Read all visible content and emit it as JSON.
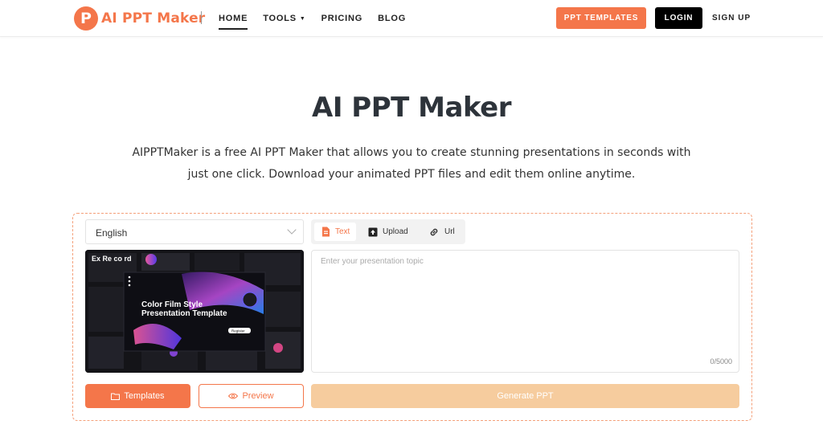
{
  "nav": {
    "logo_letter": "P",
    "logo_text": "AI PPT Maker",
    "links": [
      {
        "label": "HOME",
        "active": true
      },
      {
        "label": "TOOLS",
        "has_caret": true
      },
      {
        "label": "PRICING"
      },
      {
        "label": "BLOG"
      }
    ],
    "ppt_templates": "PPT TEMPLATES",
    "login": "LOGIN",
    "signup": "SIGN UP"
  },
  "hero": {
    "title": "AI PPT Maker",
    "description": "AIPPTMaker is a free AI PPT Maker that allows you to create stunning presentations in seconds with just one click. Download your animated PPT files and edit them online anytime."
  },
  "generator": {
    "language": "English",
    "preview_image": {
      "slide_title_line1": "Color Film Style",
      "slide_title_line2": "Presentation Template",
      "slide_button": "Register",
      "side_text": "Ex Re co rd"
    },
    "tabs": [
      {
        "label": "Text",
        "icon": "document-icon",
        "active": true
      },
      {
        "label": "Upload",
        "icon": "upload-icon"
      },
      {
        "label": "Url",
        "icon": "link-icon"
      }
    ],
    "topic_placeholder": "Enter your presentation topic",
    "counter": "0/5000",
    "templates_button": "Templates",
    "preview_button": "Preview",
    "generate_button": "Generate PPT"
  },
  "colors": {
    "accent": "#f4764a",
    "generate_disabled": "#f6cc9e",
    "dark": "#000000"
  }
}
